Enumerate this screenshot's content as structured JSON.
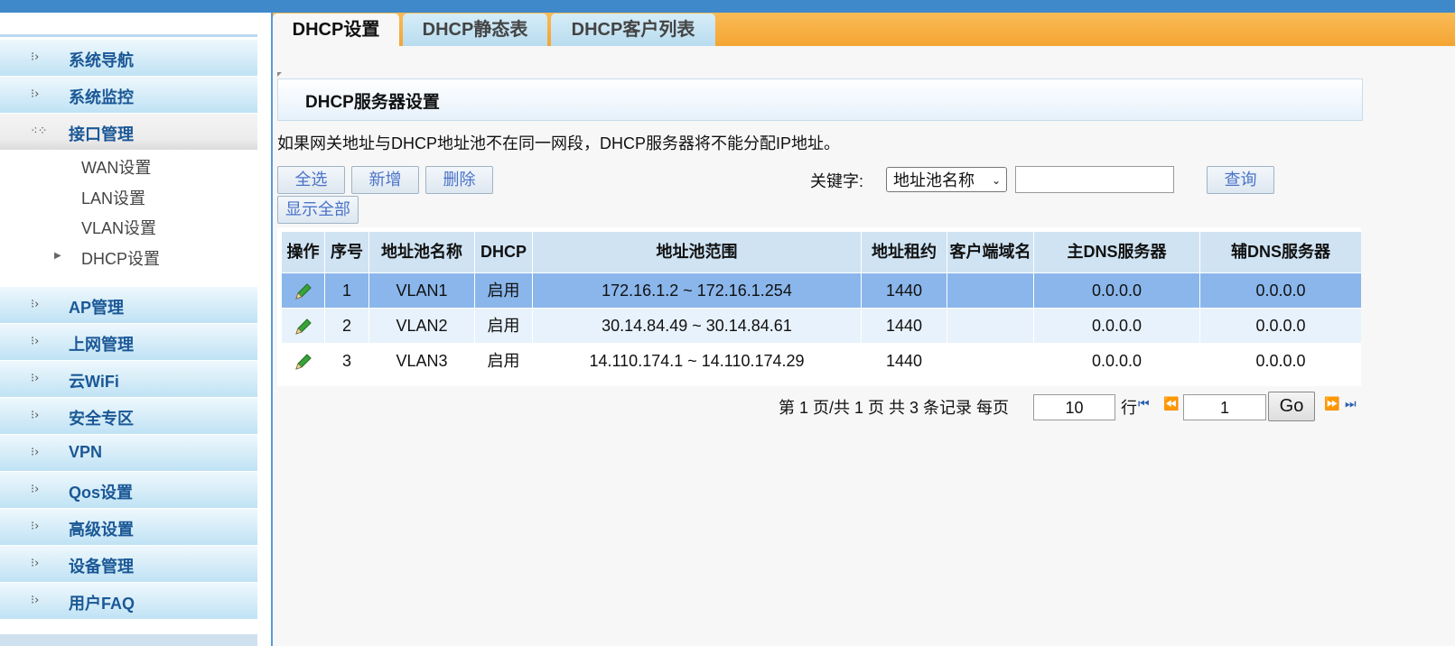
{
  "sidebar": {
    "items": [
      {
        "label": "系统导航"
      },
      {
        "label": "系统监控"
      },
      {
        "label": "接口管理"
      },
      {
        "label": "AP管理"
      },
      {
        "label": "上网管理"
      },
      {
        "label": "云WiFi"
      },
      {
        "label": "安全专区"
      },
      {
        "label": "VPN"
      },
      {
        "label": "Qos设置"
      },
      {
        "label": "高级设置"
      },
      {
        "label": "设备管理"
      },
      {
        "label": "用户FAQ"
      }
    ],
    "sub_items": [
      {
        "label": "WAN设置"
      },
      {
        "label": "LAN设置"
      },
      {
        "label": "VLAN设置"
      },
      {
        "label": "DHCP设置"
      }
    ]
  },
  "tabs": [
    {
      "label": "DHCP设置"
    },
    {
      "label": "DHCP静态表"
    },
    {
      "label": "DHCP客户列表"
    }
  ],
  "section": {
    "title": "DHCP服务器设置",
    "notice": "如果网关地址与DHCP地址池不在同一网段，DHCP服务器将不能分配IP地址。"
  },
  "toolbar": {
    "select_all": "全选",
    "add": "新增",
    "delete": "删除",
    "show_all": "显示全部",
    "keyword_label": "关键字:",
    "keyword_select": "地址池名称",
    "keyword_value": "",
    "search": "查询"
  },
  "table": {
    "headers": [
      "操作",
      "序号",
      "地址池名称",
      "DHCP",
      "地址池范围",
      "地址租约",
      "客户端域名",
      "主DNS服务器",
      "辅DNS服务器"
    ],
    "rows": [
      {
        "index": "1",
        "name": "VLAN1",
        "dhcp": "启用",
        "range": "172.16.1.2 ~ 172.16.1.254",
        "lease": "1440",
        "domain": "",
        "dns1": "0.0.0.0",
        "dns2": "0.0.0.0"
      },
      {
        "index": "2",
        "name": "VLAN2",
        "dhcp": "启用",
        "range": "30.14.84.49 ~ 30.14.84.61",
        "lease": "1440",
        "domain": "",
        "dns1": "0.0.0.0",
        "dns2": "0.0.0.0"
      },
      {
        "index": "3",
        "name": "VLAN3",
        "dhcp": "启用",
        "range": "14.110.174.1 ~ 14.110.174.29",
        "lease": "1440",
        "domain": "",
        "dns1": "0.0.0.0",
        "dns2": "0.0.0.0"
      }
    ]
  },
  "pager": {
    "summary": "第 1 页/共 1 页 共 3 条记录 每页",
    "per_page": "10",
    "rows_unit": "行",
    "page_input": "1",
    "go": "Go"
  },
  "icons": {
    "nav": "bullet-dots-icon",
    "edit": "pencil-icon",
    "first": "first-page-icon",
    "prev": "prev-page-icon",
    "next": "next-page-icon",
    "last": "last-page-icon"
  },
  "colors": {
    "accent_blue": "#3f88c9",
    "tab_orange": "#f4a533",
    "selected_row": "#8ab6eb",
    "nav_text": "#1b5896"
  }
}
